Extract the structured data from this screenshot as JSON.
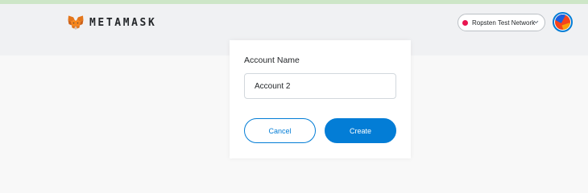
{
  "header": {
    "wordmark": "METAMASK",
    "logo_icon": "metamask-fox-icon",
    "network": {
      "label": "Ropsten Test Network",
      "dot_color": "#e91550",
      "chevron_icon": "chevron-down-icon"
    },
    "avatar_icon": "account-identicon"
  },
  "form": {
    "label": "Account Name",
    "account_name_value": "Account 2",
    "cancel_label": "Cancel",
    "create_label": "Create"
  },
  "colors": {
    "primary": "#037dd6",
    "header_bg": "#f0f1f3",
    "page_bg": "#f8f8f8",
    "top_strip": "#cde6c7"
  }
}
